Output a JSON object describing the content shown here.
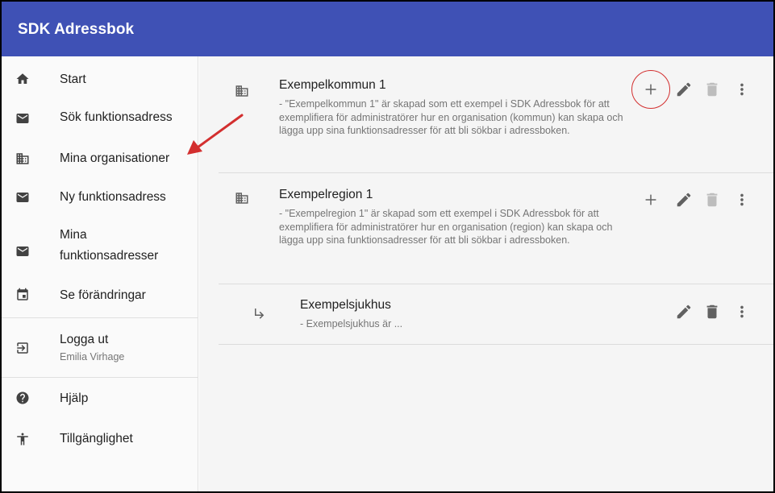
{
  "app": {
    "title": "SDK Adressbok"
  },
  "sidebar": {
    "items": [
      {
        "label": "Start",
        "icon": "home-icon"
      },
      {
        "label": "Sök funktionsadress",
        "icon": "mail-icon"
      },
      {
        "label": "Mina organisationer",
        "icon": "building-icon"
      },
      {
        "label": "Ny funktionsadress",
        "icon": "mail-icon"
      },
      {
        "label": "Mina funktionsadresser",
        "icon": "mail-icon"
      },
      {
        "label": "Se förändringar",
        "icon": "calendar-icon"
      },
      {
        "label": "Logga ut",
        "sublabel": "Emilia Virhage",
        "icon": "logout-icon"
      },
      {
        "label": "Hjälp",
        "icon": "help-icon"
      },
      {
        "label": "Tillgänglighet",
        "icon": "accessibility-icon"
      }
    ]
  },
  "organisations": [
    {
      "name": "Exempelkommun 1",
      "description": " - \"Exempelkommun 1\" är skapad som ett exempel i SDK Adressbok för att exemplifiera för administratörer hur en organisation (kommun) kan skapa och lägga upp sina funktionsadresser för att bli sökbar i adressboken.",
      "icon": "building-icon",
      "actions": [
        "add-icon",
        "edit-icon",
        "delete-icon",
        "more-icon"
      ]
    },
    {
      "name": "Exempelregion 1",
      "description": " - \"Exempelregion 1\" är skapad som ett exempel i SDK Adressbok för att exemplifiera för administratörer hur en organisation (region) kan skapa och lägga upp sina funktionsadresser för att bli sökbar i adressboken.",
      "icon": "building-icon",
      "actions": [
        "add-icon",
        "edit-icon",
        "delete-icon",
        "more-icon"
      ]
    },
    {
      "name": "Exempelsjukhus",
      "description": " - Exempelsjukhus är ...",
      "icon": "subdirectory-arrow-icon",
      "actions": [
        "edit-icon",
        "delete-icon",
        "more-icon"
      ]
    }
  ],
  "colors": {
    "appbar": "#3f51b5",
    "annotation": "#d32f2f",
    "icon_active": "#616161",
    "icon_disabled": "#bdbdbd"
  }
}
